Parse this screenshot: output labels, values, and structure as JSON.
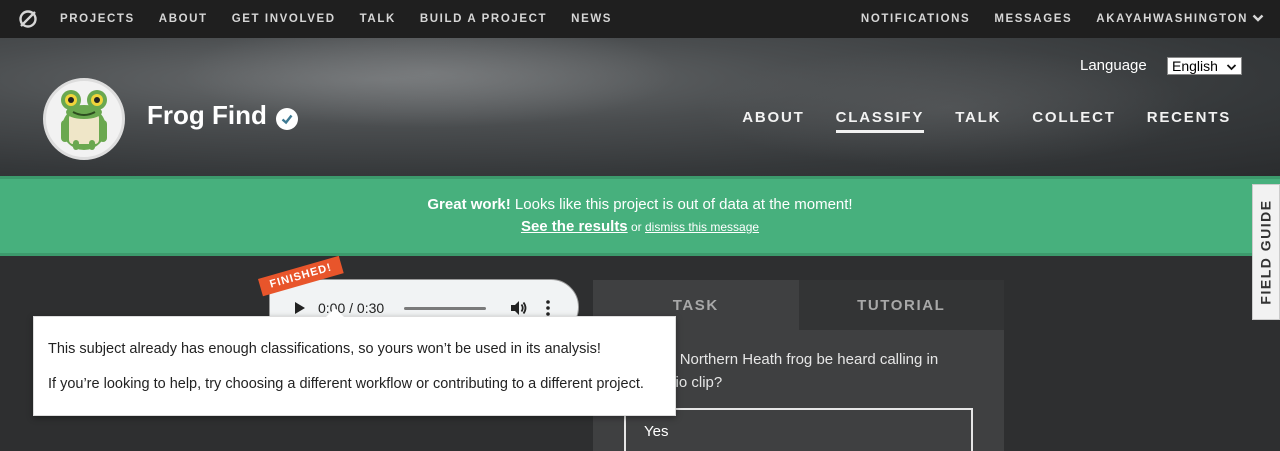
{
  "topnav": {
    "items": [
      "PROJECTS",
      "ABOUT",
      "GET INVOLVED",
      "TALK",
      "BUILD A PROJECT",
      "NEWS"
    ],
    "right": [
      "NOTIFICATIONS",
      "MESSAGES"
    ],
    "username": "AKAYAHWASHINGTON"
  },
  "header": {
    "project_title": "Frog Find",
    "language_label": "Language",
    "language_value": "English",
    "nav": [
      "ABOUT",
      "CLASSIFY",
      "TALK",
      "COLLECT",
      "RECENTS"
    ],
    "active_nav": "CLASSIFY"
  },
  "banner": {
    "strong": "Great work!",
    "message": " Looks like this project is out of data at the moment!",
    "results_link": "See the results",
    "or": " or ",
    "dismiss_link": "dismiss this message"
  },
  "field_guide": "FIELD GUIDE",
  "player": {
    "time": "0:00 / 0:30",
    "badge": "FINISHED!"
  },
  "task": {
    "tabs": [
      "TASK",
      "TUTORIAL"
    ],
    "question": "Can the Northern Heath frog be heard calling in this audio clip?",
    "answer": "Yes"
  },
  "popup": {
    "line1": "This subject already has enough classifications, so yours won’t be used in its analysis!",
    "line2": "If you’re looking to help, try choosing a different workflow or contributing to a different project."
  },
  "colors": {
    "banner": "#47b07d",
    "finished_badge": "#e8552b",
    "topnav": "#1f1f1f"
  }
}
